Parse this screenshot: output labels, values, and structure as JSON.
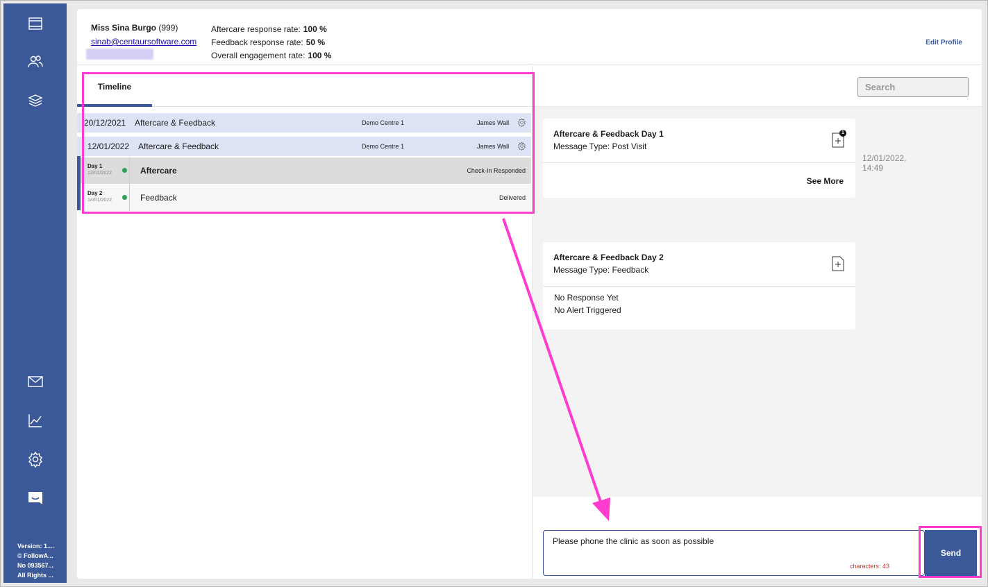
{
  "sidebar": {
    "icons": [
      "dashboard-icon",
      "clients-icon",
      "layers-icon",
      "mail-icon",
      "chart-icon",
      "settings-icon",
      "chat-icon"
    ],
    "footer": [
      "Version: 1....",
      "© FollowA...",
      "No 093567...",
      "All Rights ..."
    ]
  },
  "header": {
    "client_name": "Miss Sina Burgo",
    "client_number": "(999)",
    "client_email": "sinab@centaursoftware.com",
    "rates": [
      {
        "label": "Aftercare response rate:",
        "value": "100 %"
      },
      {
        "label": "Feedback response rate:",
        "value": "50 %"
      },
      {
        "label": "Overall engagement rate:",
        "value": "100 %"
      }
    ],
    "edit_profile": "Edit Profile"
  },
  "timeline": {
    "tab_label": "Timeline",
    "rows": [
      {
        "date": "20/12/2021",
        "title": "Aftercare & Feedback",
        "centre": "Demo Centre 1",
        "person": "James Wall"
      },
      {
        "date": "12/01/2022",
        "title": "Aftercare & Feedback",
        "centre": "Demo Centre 1",
        "person": "James Wall"
      }
    ],
    "days": [
      {
        "label": "Day 1",
        "date": "12/01/2022",
        "name": "Aftercare",
        "status": "Check-In Responded"
      },
      {
        "label": "Day 2",
        "date": "14/01/2022",
        "name": "Feedback",
        "status": "Delivered"
      }
    ]
  },
  "search": {
    "placeholder": "Search"
  },
  "messages": [
    {
      "title": "Aftercare & Feedback Day 1",
      "type": "Message Type: Post Visit",
      "badge": "1",
      "see_more": "See More",
      "timestamp_date": "12/01/2022,",
      "timestamp_time": "14:49"
    },
    {
      "title": "Aftercare & Feedback Day 2",
      "type": "Message Type: Feedback",
      "response": "No Response Yet",
      "alert": "No Alert Triggered"
    }
  ],
  "composer": {
    "message": "Please phone the clinic as soon as possible",
    "char_count": "characters: 43",
    "send_label": "Send"
  },
  "colors": {
    "brand": "#3b5998",
    "highlight": "#ff3ccf",
    "status_dot": "#2e9d58"
  }
}
